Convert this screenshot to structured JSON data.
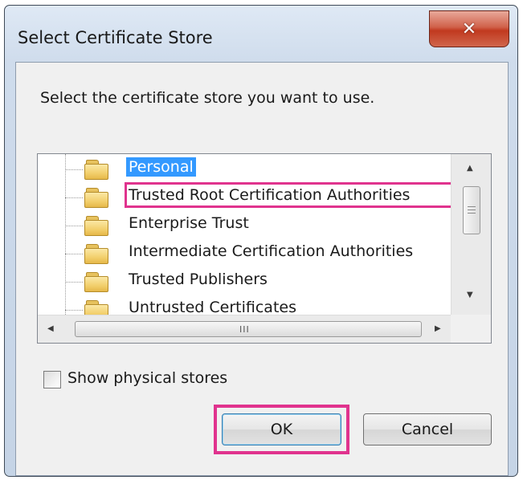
{
  "window": {
    "title": "Select Certificate Store",
    "close_glyph": "✕"
  },
  "prompt": "Select the certificate store you want to use.",
  "stores": [
    {
      "label": "Personal",
      "selected": true
    },
    {
      "label": "Trusted Root Certification Authorities",
      "selected": false,
      "highlighted": true
    },
    {
      "label": "Enterprise Trust",
      "selected": false
    },
    {
      "label": "Intermediate Certification Authorities",
      "selected": false
    },
    {
      "label": "Trusted Publishers",
      "selected": false
    },
    {
      "label": "Untrusted Certificates",
      "selected": false
    }
  ],
  "options": {
    "show_physical_label": "Show physical stores",
    "show_physical_checked": false
  },
  "buttons": {
    "ok": "OK",
    "cancel": "Cancel"
  },
  "scrollbar": {
    "grip_glyph": "III"
  },
  "colors": {
    "selection": "#3399ff",
    "callout": "#e0338e"
  }
}
